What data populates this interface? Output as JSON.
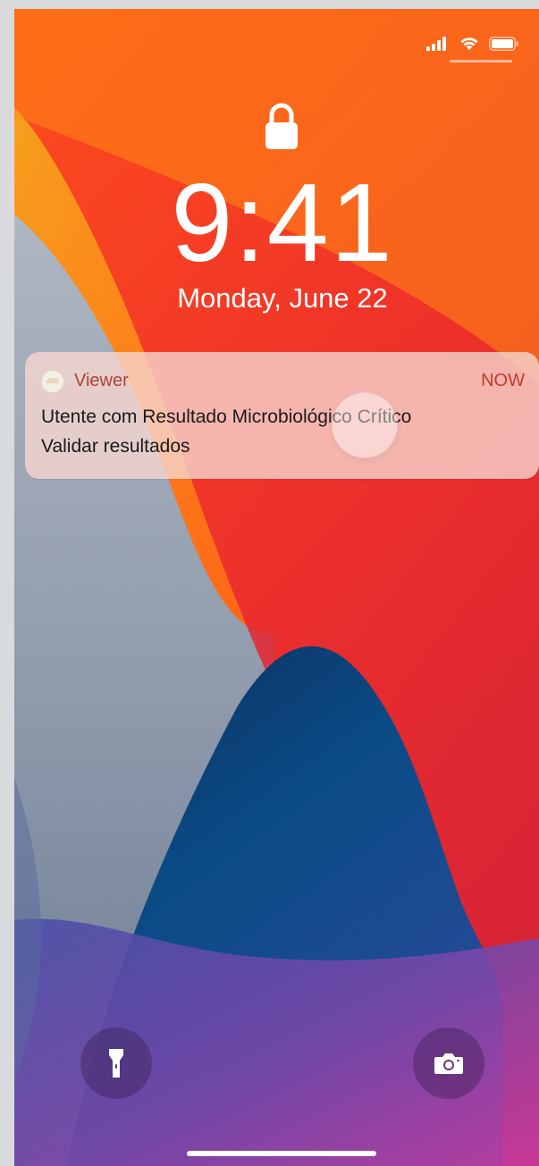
{
  "lock_screen": {
    "time": "9:41",
    "date": "Monday, June 22"
  },
  "status_bar": {
    "icons": [
      "cellular-signal-icon",
      "wifi-icon",
      "battery-icon"
    ]
  },
  "notification": {
    "app_icon": "viewer-app-icon",
    "app_name": "Viewer",
    "time": "NOW",
    "title": "Utente com Resultado Microbiológico Crítico",
    "body": "Validar resultados"
  },
  "quick_actions": {
    "left_icon": "flashlight-icon",
    "right_icon": "camera-icon"
  },
  "colors": {
    "accent": "#c23a2a",
    "notification_background": "#f6d6d0",
    "wallpaper_orange": "#ff7a12",
    "wallpaper_red": "#e52a32",
    "wallpaper_blue": "#0b4a84",
    "wallpaper_grey": "#9aa5b4"
  }
}
